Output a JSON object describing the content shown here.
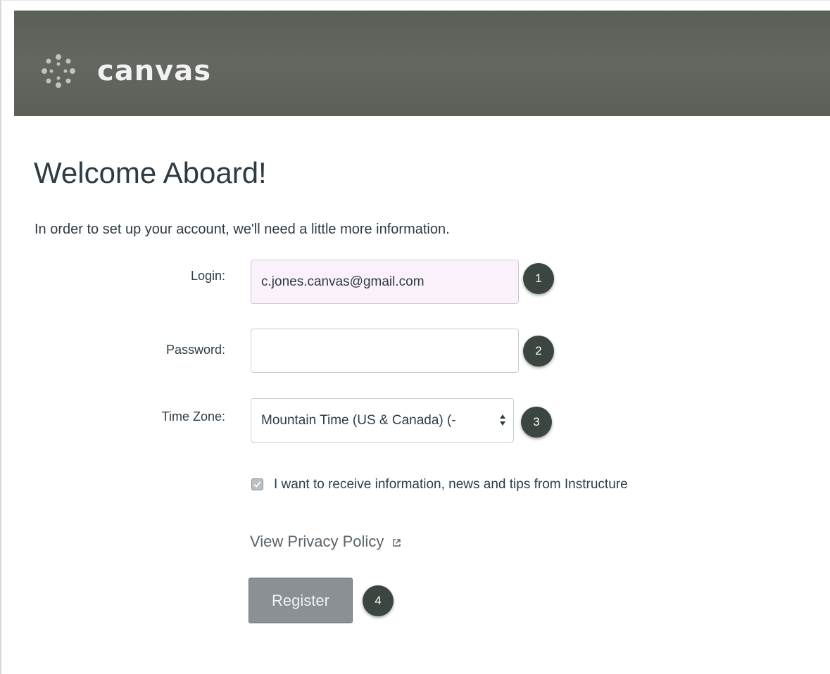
{
  "header": {
    "brand": "canvas",
    "logo_icon": "canvas-logo-icon",
    "background_color": "#5e635c"
  },
  "page": {
    "title": "Welcome Aboard!",
    "intro": "In order to set up your account, we'll need a little more information."
  },
  "form": {
    "login": {
      "label": "Login:",
      "value": "c.jones.canvas@gmail.com"
    },
    "password": {
      "label": "Password:",
      "value": ""
    },
    "timezone": {
      "label": "Time Zone:",
      "selected": "Mountain Time (US & Canada) (-"
    },
    "newsletter": {
      "label": "I want to receive information, news and tips from Instructure",
      "checked": true
    },
    "privacy_link": "View Privacy Policy",
    "register_label": "Register"
  },
  "markers": [
    "1",
    "2",
    "3",
    "4"
  ],
  "colors": {
    "marker": "#3b4640",
    "register_button": "#8b9094",
    "text": "#2d3b45",
    "login_field_bg": "#fbf1fa"
  }
}
